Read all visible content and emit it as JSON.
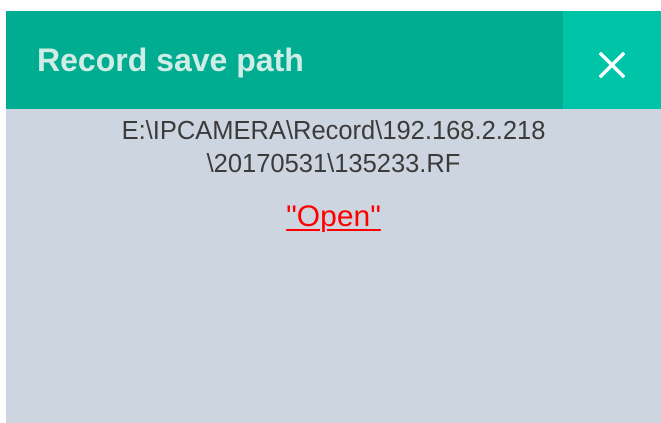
{
  "dialog": {
    "title": "Record save path",
    "close_icon": "close-icon",
    "path_line_1": "E:\\IPCAMERA\\Record\\192.168.2.218",
    "path_line_2": "\\20170531\\135233.RF",
    "open_label": "\"Open\""
  },
  "colors": {
    "titlebar": "#00ad90",
    "close_button": "#00c4a7",
    "body": "#cdd5e0",
    "link": "#ff0000"
  }
}
